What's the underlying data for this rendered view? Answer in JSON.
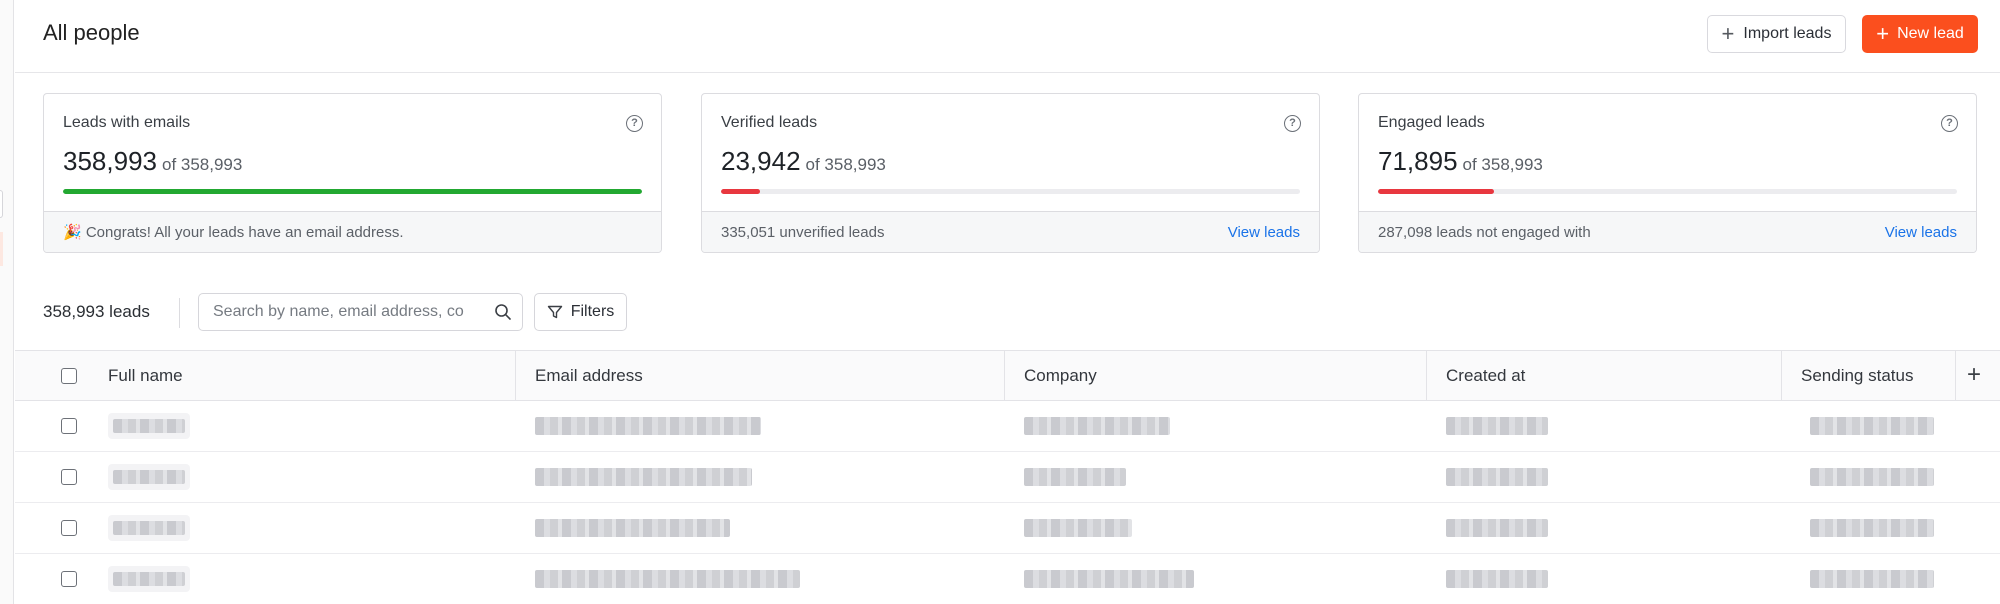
{
  "header": {
    "title": "All people",
    "import_label": "Import leads",
    "new_label": "New lead"
  },
  "cards": [
    {
      "title": "Leads with emails",
      "value": "358,993",
      "of_text": "of 358,993",
      "progress": 1.0,
      "bar_color": "#22a831",
      "footer_text": "🎉 Congrats! All your leads have an email address.",
      "link_text": ""
    },
    {
      "title": "Verified leads",
      "value": "23,942",
      "of_text": "of 358,993",
      "progress": 0.0667,
      "bar_color": "#e8373f",
      "footer_text": "335,051 unverified leads",
      "link_text": "View leads"
    },
    {
      "title": "Engaged leads",
      "value": "71,895",
      "of_text": "of 358,993",
      "progress": 0.2003,
      "bar_color": "#e8373f",
      "footer_text": "287,098 leads not engaged with",
      "link_text": "View leads"
    }
  ],
  "toolbar": {
    "lead_count": "358,993 leads",
    "search_placeholder": "Search by name, email address, co",
    "filters_label": "Filters"
  },
  "table": {
    "columns": [
      "Full name",
      "Email address",
      "Company",
      "Created at",
      "Sending status"
    ],
    "rows": [
      {
        "full_name": "",
        "email": "",
        "company": "",
        "created_at": "",
        "status": ""
      },
      {
        "full_name": "",
        "email": "",
        "company": "",
        "created_at": "",
        "status": ""
      },
      {
        "full_name": "",
        "email": "",
        "company": "",
        "created_at": "",
        "status": ""
      },
      {
        "full_name": "",
        "email": "",
        "company": "",
        "created_at": "",
        "status": ""
      }
    ]
  },
  "icons": [
    "plus-icon",
    "help-icon",
    "search-icon",
    "filter-icon",
    "checkbox-icon"
  ],
  "colors": {
    "accent": "#fb4f1e",
    "link": "#1a73e8",
    "success": "#22a831",
    "danger": "#e8373f"
  }
}
